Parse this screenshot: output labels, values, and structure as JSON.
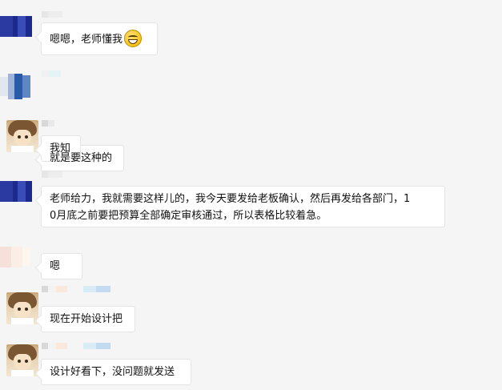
{
  "messages": [
    {
      "id": "m1",
      "text": "嗯嗯，老师懂我",
      "emoji": "grinning-face"
    },
    {
      "id": "m2",
      "text": "就是要这种的"
    },
    {
      "id": "m3",
      "text": "我知"
    },
    {
      "id": "m4",
      "line1": "老师给力，我就需要这样儿的，我今天要发给老板确认，然后再发给各部门，1",
      "line2": "0月底之前要把预算全部确定审核通过，所以表格比较着急。"
    },
    {
      "id": "m5",
      "text": "嗯"
    },
    {
      "id": "m6",
      "text": "现在开始设计把"
    },
    {
      "id": "m7",
      "text": "设计好看下，没问题就发送"
    }
  ],
  "colors": {
    "background": "#f5f5f5",
    "bubble": "#ffffff",
    "bubble_border": "#e4e4e4",
    "text": "#111111"
  }
}
